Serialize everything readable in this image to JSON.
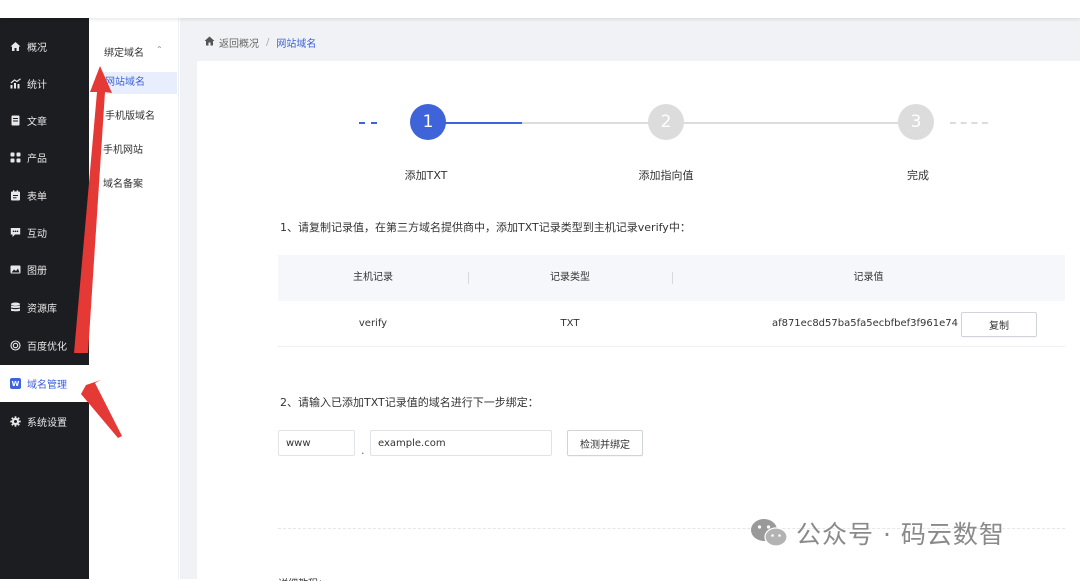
{
  "sidebar": {
    "items": [
      {
        "label": "概况",
        "icon": "home-icon"
      },
      {
        "label": "统计",
        "icon": "stats-icon"
      },
      {
        "label": "文章",
        "icon": "article-icon"
      },
      {
        "label": "产品",
        "icon": "product-icon"
      },
      {
        "label": "表单",
        "icon": "form-icon"
      },
      {
        "label": "互动",
        "icon": "chat-icon"
      },
      {
        "label": "图册",
        "icon": "gallery-icon"
      },
      {
        "label": "资源库",
        "icon": "database-icon"
      },
      {
        "label": "百度优化",
        "icon": "seo-icon"
      },
      {
        "label": "域名管理",
        "icon": "domain-icon",
        "icon_text": "W"
      },
      {
        "label": "系统设置",
        "icon": "gear-icon"
      }
    ],
    "active_index": 9
  },
  "submenu": {
    "title": "绑定域名",
    "items": [
      "网站域名",
      "手机版域名",
      "手机网站",
      "域名备案"
    ]
  },
  "breadcrumb": {
    "home": "返回概况",
    "separator": "/",
    "current": "网站域名"
  },
  "steps": [
    {
      "number": "1",
      "label": "添加TXT"
    },
    {
      "number": "2",
      "label": "添加指向值"
    },
    {
      "number": "3",
      "label": "完成"
    }
  ],
  "step1_instruction": "1、请复制记录值，在第三方域名提供商中，添加TXT记录类型到主机记录verify中：",
  "table": {
    "headers": [
      "主机记录",
      "记录类型",
      "记录值"
    ],
    "row": {
      "host": "verify",
      "type": "TXT",
      "value": "af871ec8d57ba5fa5ecbfbef3f961e74"
    },
    "copy_label": "复制"
  },
  "step2_instruction": "2、请输入已添加TXT记录值的域名进行下一步绑定：",
  "form": {
    "subdomain": "www",
    "dot": ".",
    "domain": "example.com",
    "bind_label": "检测并绑定"
  },
  "bottom_text": "详细教程：",
  "watermark": {
    "text": "公众号 · 码云数智"
  },
  "colors": {
    "accent": "#3f63d8",
    "sidebar_bg": "#1c1d21",
    "inactive_step": "#dcdcdc",
    "arrow": "#e53935"
  }
}
